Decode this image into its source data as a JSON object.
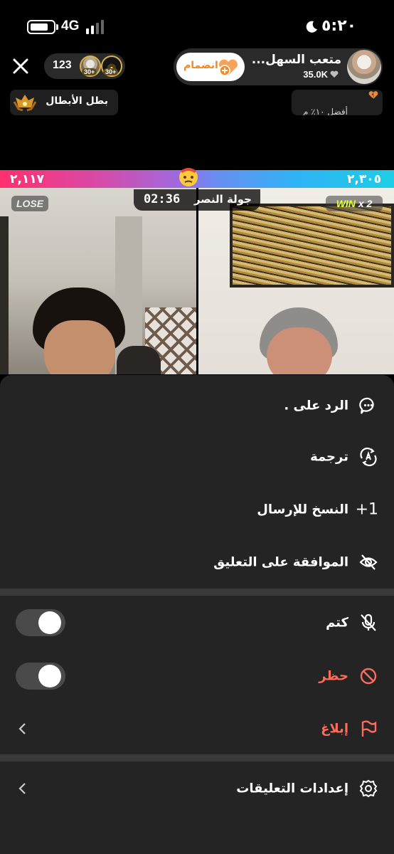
{
  "status_bar": {
    "network": "4G",
    "time": "٥:٢٠"
  },
  "live_header": {
    "viewer_count": "123",
    "viewer_badges": [
      "30+",
      "30+"
    ],
    "host_name": "متعب السهل...",
    "host_likes": "35.0K",
    "join_label": "انضمام",
    "champion_label": "بطل الأبطال",
    "right_badge_text": "أفضل ١٠٪ م"
  },
  "battle": {
    "score_left": "٢,١١٧",
    "score_right": "٢,٣٠٥",
    "timer": "02:36",
    "round_label": "جولة النصر",
    "lose_label": "LOSE",
    "win_label": "WIN",
    "win_multiplier": "x 2"
  },
  "sheet": {
    "reply_label": "الرد على .",
    "translate_label": "ترجمة",
    "copy_send_label": "النسخ للإرسال",
    "copy_send_prefix": "+1",
    "approve_label": "الموافقة على التعليق",
    "mute_label": "كتم",
    "block_label": "حظر",
    "report_label": "إبلاغ",
    "comment_settings_label": "إعدادات التعليقات"
  },
  "colors": {
    "accent_red": "#ff6b5b",
    "join_orange": "#f08a24",
    "sheet_bg": "#242424"
  }
}
